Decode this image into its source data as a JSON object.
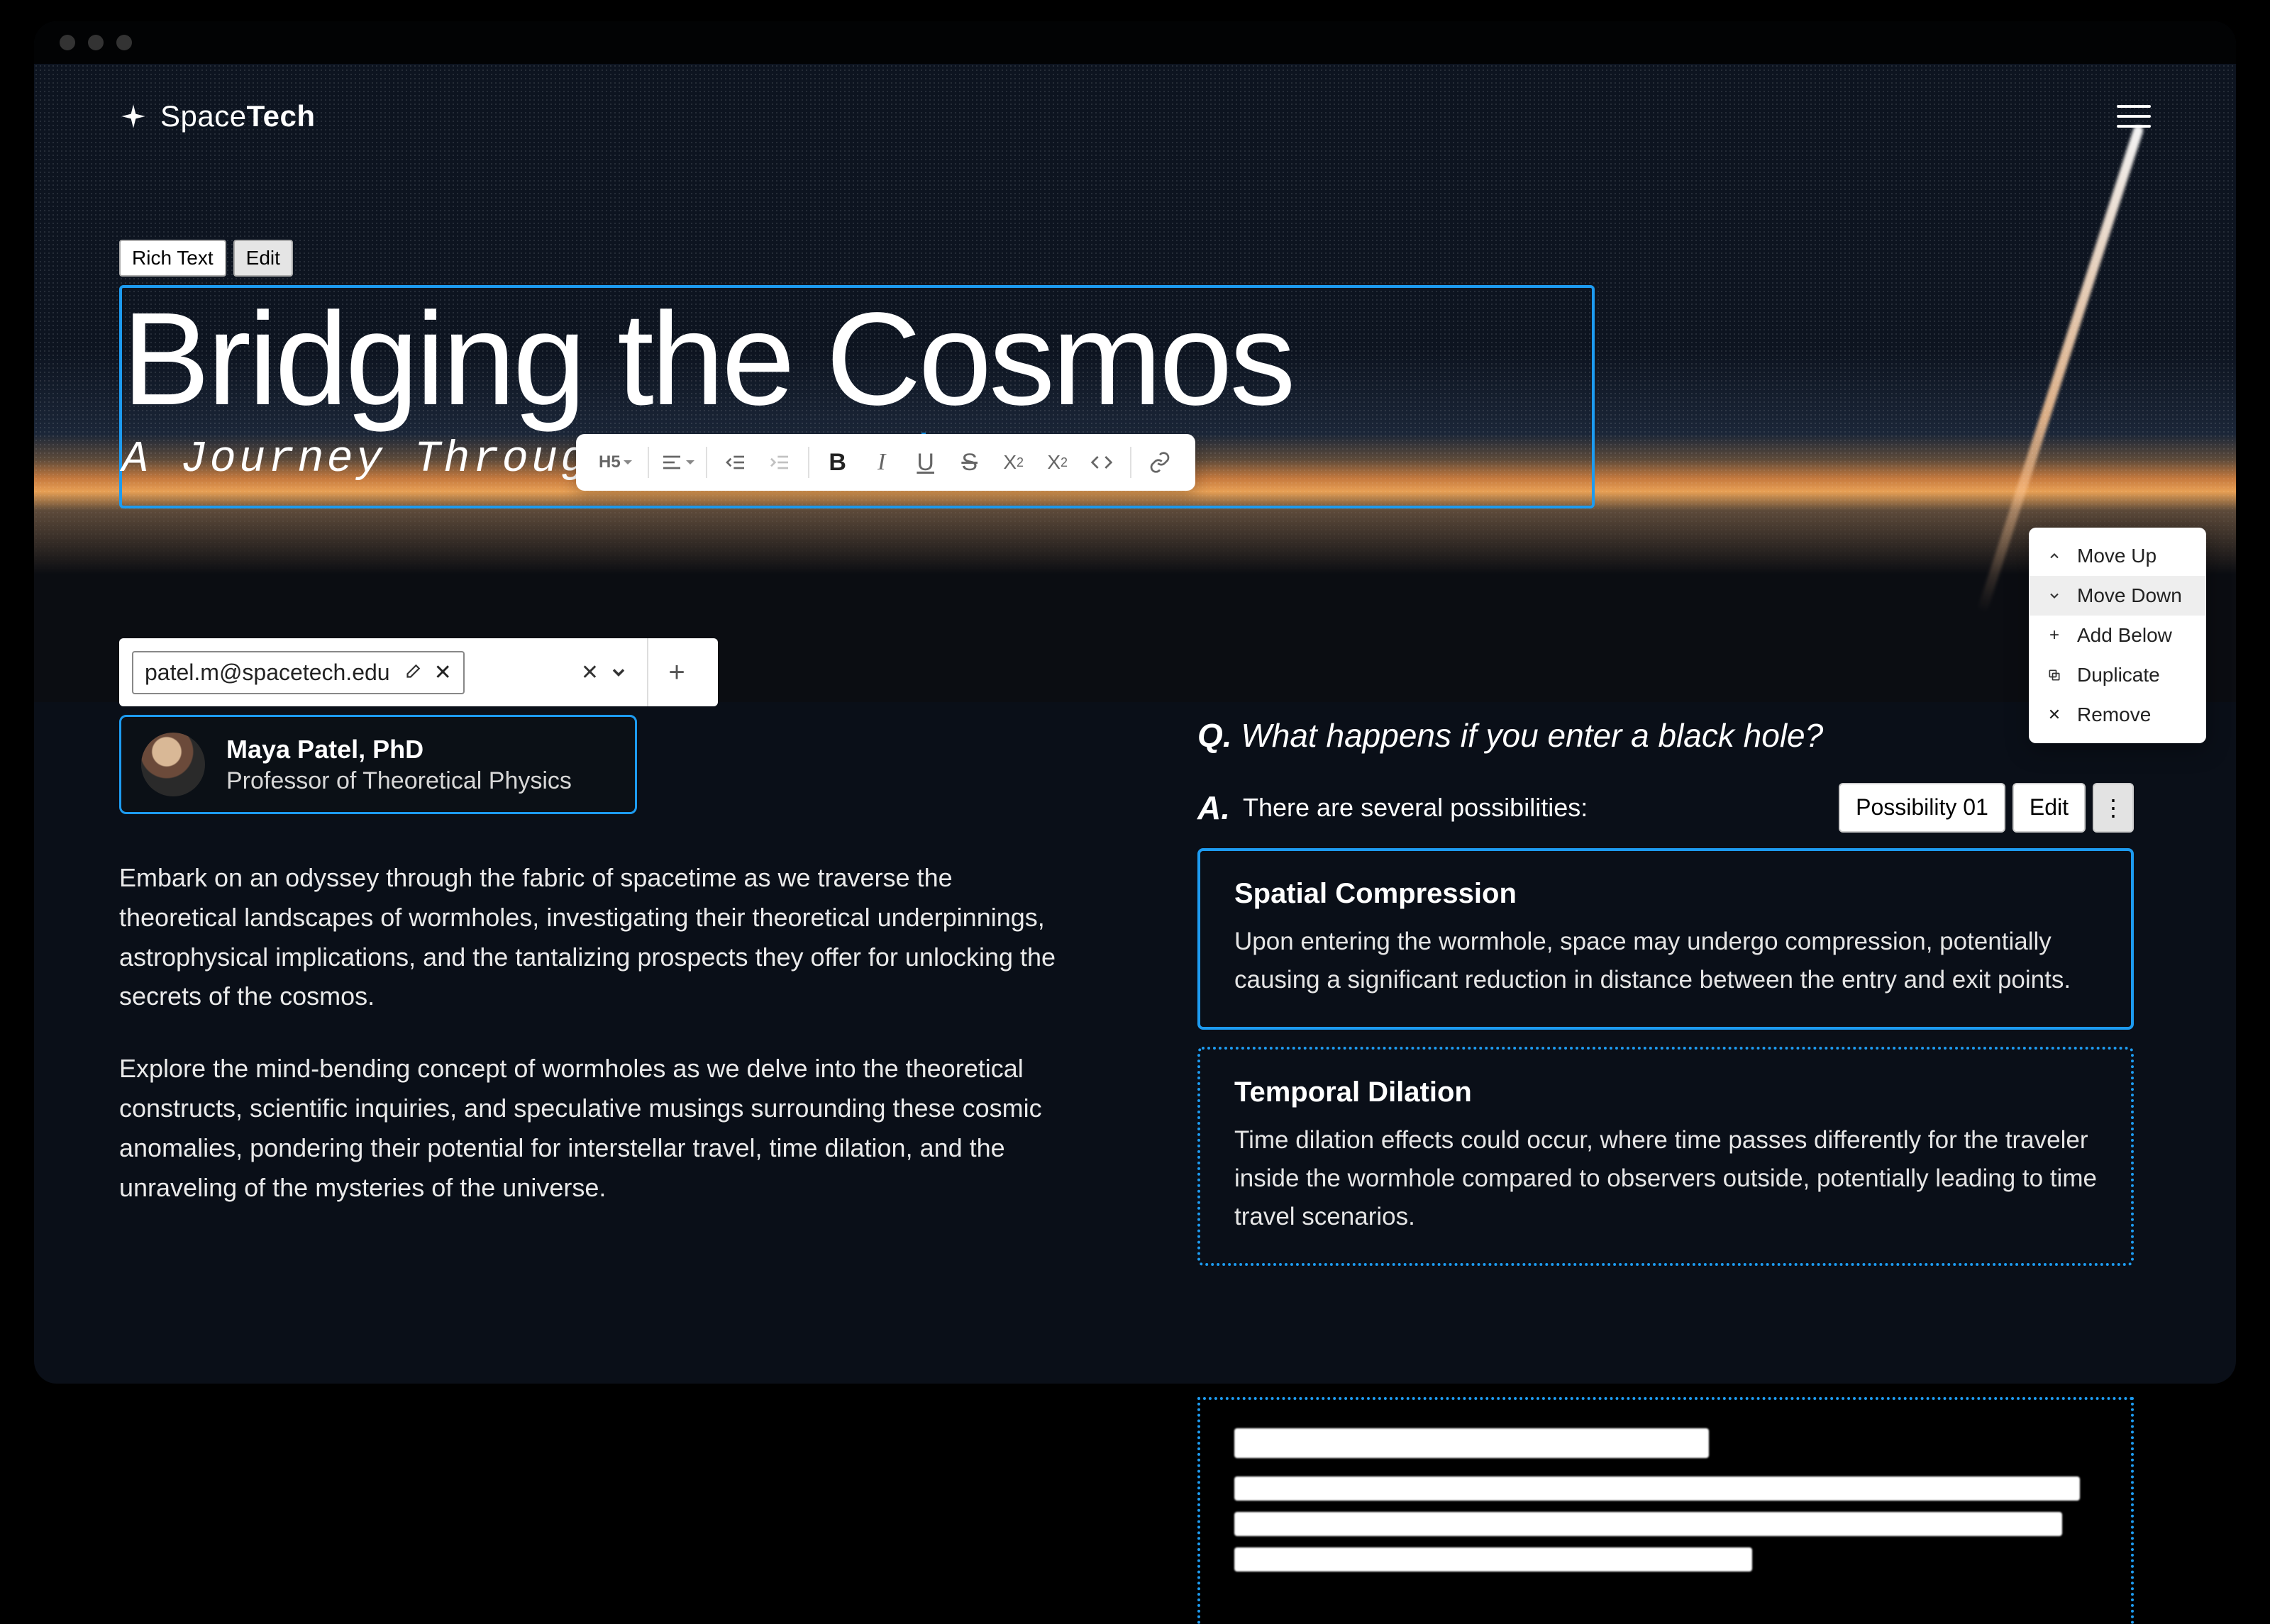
{
  "brand": {
    "prefix": "Space",
    "suffix": "Tech"
  },
  "title_block": {
    "chip_kind": "Rich Text",
    "chip_mode": "Edit",
    "heading": "Bridging the Cosmos",
    "subheading": "A Journey Through Wormholes"
  },
  "format_toolbar": {
    "heading_level": "H5"
  },
  "tag_input": {
    "value": "patel.m@spacetech.edu"
  },
  "author": {
    "name": "Maya Patel, PhD",
    "role": "Professor of Theoretical Physics"
  },
  "body": {
    "p1": "Embark on an odyssey through the fabric of spacetime as we traverse the theoretical landscapes of wormholes, investigating their theoretical underpinnings, astrophysical implications, and the tantalizing prospects they offer for unlocking the secrets of the cosmos.",
    "p2": "Explore the mind-bending concept of wormholes as we delve into the theoretical constructs, scientific inquiries, and speculative musings surrounding these cosmic anomalies, pondering their potential for interstellar travel, time dilation, and the unraveling of the mysteries of the universe."
  },
  "qa": {
    "q_prefix": "Q.",
    "question": "What happens if you enter a black hole?",
    "a_prefix": "A.",
    "answer_intro": "There are several possibilities:",
    "controls": {
      "variant": "Possibility 01",
      "edit": "Edit"
    },
    "items": [
      {
        "title": "Spatial Compression",
        "body": "Upon entering the wormhole, space may undergo compression, potentially causing a significant reduction in distance between the entry and exit points."
      },
      {
        "title": "Temporal Dilation",
        "body": "Time dilation effects could occur, where time passes differently for the traveler inside the wormhole compared to observers outside, potentially leading to time travel scenarios."
      }
    ]
  },
  "context_menu": {
    "move_up": "Move Up",
    "move_down": "Move Down",
    "add_below": "Add Below",
    "duplicate": "Duplicate",
    "remove": "Remove"
  }
}
